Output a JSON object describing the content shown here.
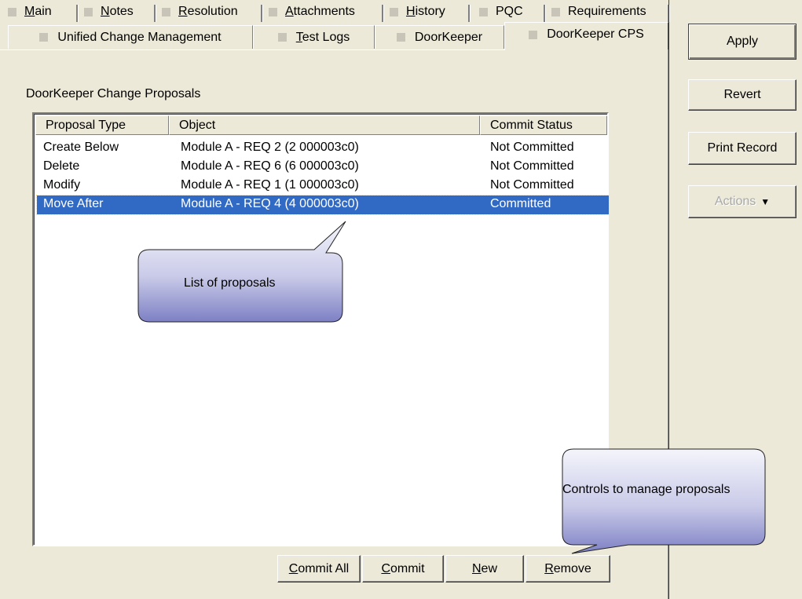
{
  "tabs_row1": [
    {
      "prefix": "",
      "ul": "M",
      "rest": "ain"
    },
    {
      "prefix": "",
      "ul": "N",
      "rest": "otes"
    },
    {
      "prefix": "",
      "ul": "R",
      "rest": "esolution"
    },
    {
      "prefix": "",
      "ul": "A",
      "rest": "ttachments"
    },
    {
      "prefix": "",
      "ul": "H",
      "rest": "istory"
    },
    {
      "prefix": "PQC",
      "ul": "",
      "rest": ""
    },
    {
      "prefix": "Requirements",
      "ul": "",
      "rest": ""
    }
  ],
  "tabs_row2": [
    {
      "label": "Unified Change Management"
    },
    {
      "label_ul": "T",
      "label_rest": "est Logs"
    },
    {
      "label": "DoorKeeper"
    },
    {
      "label": "DoorKeeper CPS"
    }
  ],
  "section_label": "DoorKeeper Change Proposals",
  "list": {
    "columns": [
      "Proposal Type",
      "Object",
      "Commit Status"
    ],
    "rows": [
      {
        "type": "Create Below",
        "object": "Module A - REQ 2 (2 000003c0)",
        "status": "Not Committed"
      },
      {
        "type": "Delete",
        "object": "Module A - REQ 6 (6 000003c0)",
        "status": "Not Committed"
      },
      {
        "type": "Modify",
        "object": "Module A - REQ 1 (1 000003c0)",
        "status": "Not Committed"
      },
      {
        "type": "Move After",
        "object": "Module A - REQ 4 (4 000003c0)",
        "status": "Committed"
      }
    ],
    "selected_index": 3
  },
  "bottom_buttons": {
    "commit_all": {
      "ul": "C",
      "rest": "ommit All"
    },
    "commit": {
      "ul": "C",
      "rest": "ommit"
    },
    "new": {
      "ul": "N",
      "rest": "ew"
    },
    "remove": {
      "ul": "R",
      "rest": "emove"
    }
  },
  "side_buttons": {
    "apply": "Apply",
    "revert": "Revert",
    "print_record": "Print Record",
    "actions": "Actions"
  },
  "callouts": {
    "list": "List of proposals",
    "controls": "Controls to manage proposals"
  },
  "colors": {
    "face": "#ece9d8",
    "selection": "#316ac5",
    "callout_top": "#f4f5fb",
    "callout_bottom": "#7d80c4"
  }
}
